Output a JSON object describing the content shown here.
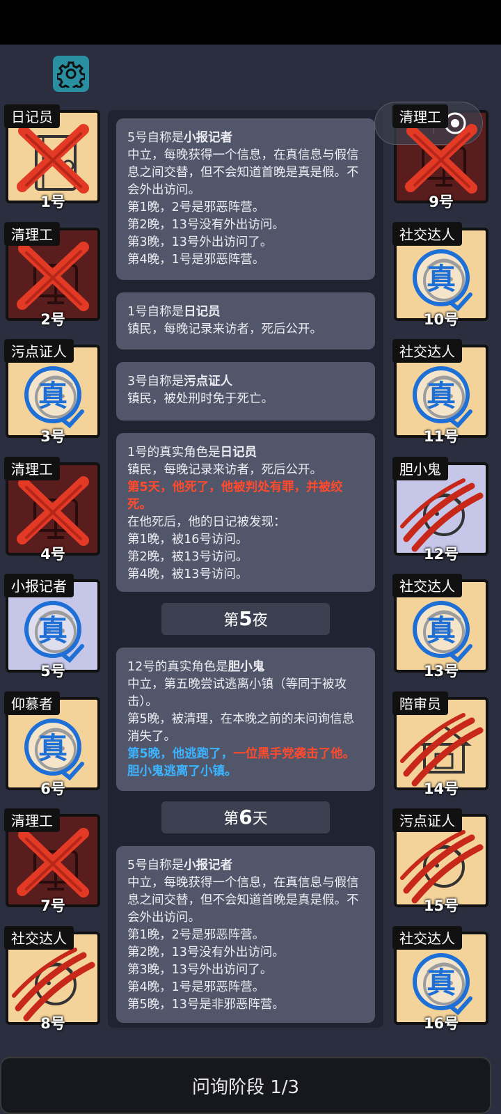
{
  "phase_label": "问询阶段 1/3",
  "players": [
    {
      "num": "1号",
      "role": "日记员",
      "state": "dead",
      "bg": "cream",
      "art": "diary"
    },
    {
      "num": "2号",
      "role": "清理工",
      "state": "dead",
      "bg": "dead",
      "art": "sweeper"
    },
    {
      "num": "3号",
      "role": "污点证人",
      "state": "verified",
      "bg": "cream",
      "art": "face"
    },
    {
      "num": "4号",
      "role": "清理工",
      "state": "dead",
      "bg": "dead",
      "art": "sweeper"
    },
    {
      "num": "5号",
      "role": "小报记者",
      "state": "verified",
      "bg": "lav",
      "art": "face"
    },
    {
      "num": "6号",
      "role": "仰慕者",
      "state": "verified",
      "bg": "cream",
      "art": "face"
    },
    {
      "num": "7号",
      "role": "清理工",
      "state": "dead",
      "bg": "dead",
      "art": "sweeper"
    },
    {
      "num": "8号",
      "role": "社交达人",
      "state": "attacked",
      "bg": "cream",
      "art": "face"
    },
    {
      "num": "9号",
      "role": "清理工",
      "state": "dead",
      "bg": "dead",
      "art": "sweeper"
    },
    {
      "num": "10号",
      "role": "社交达人",
      "state": "verified",
      "bg": "cream",
      "art": "face"
    },
    {
      "num": "11号",
      "role": "社交达人",
      "state": "verified",
      "bg": "cream",
      "art": "face"
    },
    {
      "num": "12号",
      "role": "胆小鬼",
      "state": "attacked",
      "bg": "lav",
      "art": "face"
    },
    {
      "num": "13号",
      "role": "社交达人",
      "state": "verified",
      "bg": "cream",
      "art": "face"
    },
    {
      "num": "14号",
      "role": "陪审员",
      "state": "attacked",
      "bg": "cream",
      "art": "building"
    },
    {
      "num": "15号",
      "role": "污点证人",
      "state": "attacked",
      "bg": "cream",
      "art": "face"
    },
    {
      "num": "16号",
      "role": "社交达人",
      "state": "verified",
      "bg": "cream",
      "art": "face"
    }
  ],
  "verified_glyph": "真",
  "messages": {
    "m1": {
      "prefix": "5号自称是",
      "role": "小报记者",
      "lines": [
        "中立，每晚获得一个信息，在真信息与假信息之间交替，但不会知道首晚是真是假。不会外出访问。",
        "第1晚，2号是邪恶阵营。",
        "第2晚，13号没有外出访问。",
        "第3晚，13号外出访问了。",
        "第4晚，1号是邪恶阵营。"
      ]
    },
    "m2": {
      "prefix": "1号自称是",
      "role": "日记员",
      "lines": [
        "镇民，每晚记录来访者，死后公开。"
      ]
    },
    "m3": {
      "prefix": "3号自称是",
      "role": "污点证人",
      "lines": [
        "镇民，被处刑时免于死亡。"
      ]
    },
    "m4": {
      "prefix": "1号的真实角色是",
      "role": "日记员",
      "line1": "镇民，每晚记录来访者，死后公开。",
      "red": "第5天，他死了，他被判处有罪，并被绞死。",
      "lines": [
        "在他死后，他的日记被发现：",
        "第1晚，被16号访问。",
        "第2晚，被13号访问。",
        "第4晚，被13号访问。"
      ]
    },
    "night5": {
      "pre": "第",
      "num": "5",
      "post": "夜"
    },
    "m5": {
      "prefix": "12号的真实角色是",
      "role": "胆小鬼",
      "lines": [
        "中立，第五晚尝试逃离小镇（等同于被攻击）。",
        "第5晚，被清理，在本晚之前的未问询信息消失了。"
      ],
      "blue1": "第5晚，他逃跑了，",
      "red1": "一位黑手党袭击了他。",
      "blue2": "胆小鬼逃离了小镇。"
    },
    "day6": {
      "pre": "第",
      "num": "6",
      "post": "天"
    },
    "m6": {
      "prefix": "5号自称是",
      "role": "小报记者",
      "lines": [
        "中立，每晚获得一个信息，在真信息与假信息之间交替，但不会知道首晚是真是假。不会外出访问。",
        "第1晚，2号是邪恶阵营。",
        "第2晚，13号没有外出访问。",
        "第3晚，13号外出访问了。",
        "第4晚，1号是邪恶阵营。",
        "第5晚，13号是非邪恶阵营。"
      ]
    }
  }
}
